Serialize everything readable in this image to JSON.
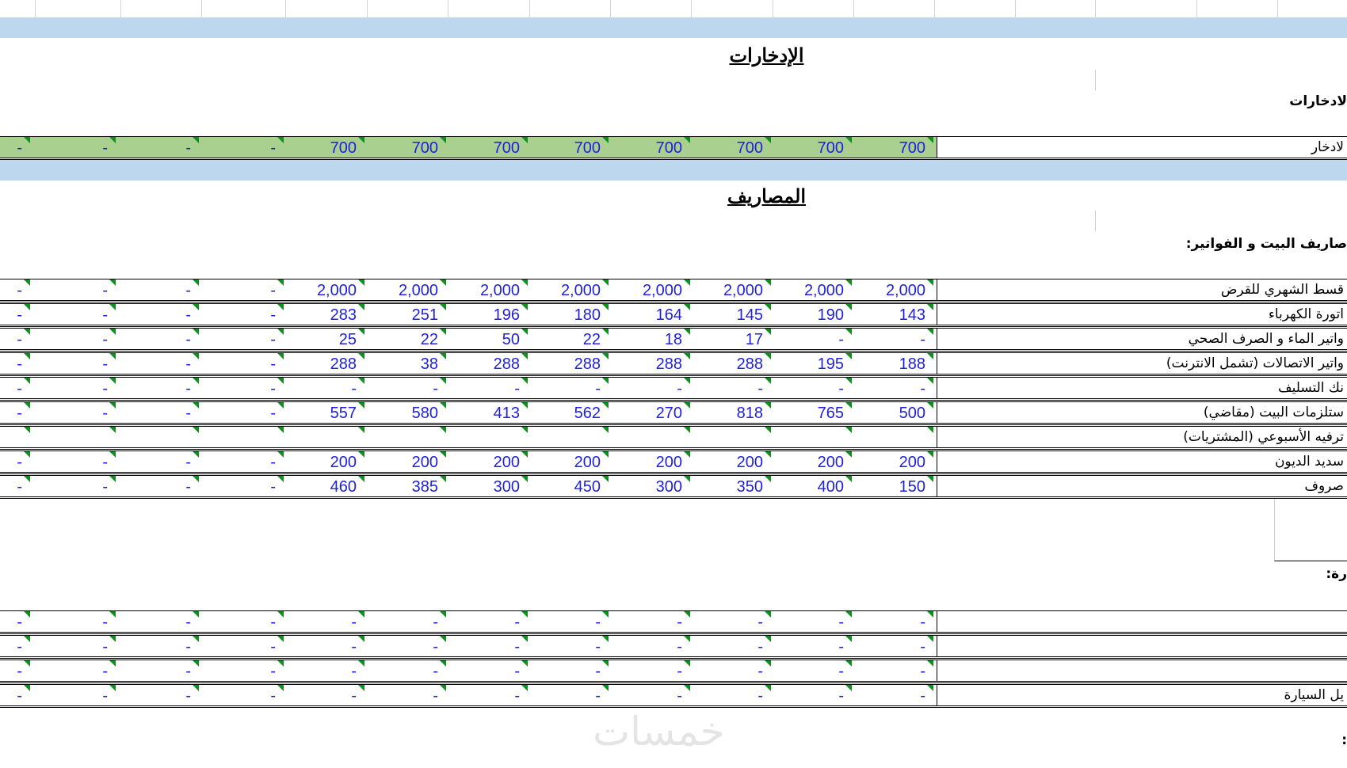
{
  "sections": {
    "savings_title": "الإدخارات",
    "expenses_title": "المصاريف"
  },
  "subheadings": {
    "savings": "لادخارات",
    "house_bills": "صاريف البيت و الفواتير:",
    "car": "رة:",
    "other": ":"
  },
  "savings_row": {
    "label": "لادخار",
    "values": [
      "-",
      "-",
      "-",
      "-",
      "700",
      "700",
      "700",
      "700",
      "700",
      "700",
      "700",
      "700"
    ]
  },
  "expense_rows": [
    {
      "label": "قسط الشهري للقرض",
      "values": [
        "-",
        "-",
        "-",
        "-",
        "2,000",
        "2,000",
        "2,000",
        "2,000",
        "2,000",
        "2,000",
        "2,000",
        "2,000"
      ]
    },
    {
      "label": "اتورة الكهرباء",
      "values": [
        "-",
        "-",
        "-",
        "-",
        "283",
        "251",
        "196",
        "180",
        "164",
        "145",
        "190",
        "143"
      ]
    },
    {
      "label": "واتير الماء و الصرف الصحي",
      "values": [
        "-",
        "-",
        "-",
        "-",
        "25",
        "22",
        "50",
        "22",
        "18",
        "17",
        "-",
        "-"
      ]
    },
    {
      "label": "واتير الاتصالات (تشمل الانترنت)",
      "values": [
        "-",
        "-",
        "-",
        "-",
        "288",
        "38",
        "288",
        "288",
        "288",
        "288",
        "195",
        "188"
      ]
    },
    {
      "label": "نك التسليف",
      "values": [
        "-",
        "-",
        "-",
        "-",
        "-",
        "-",
        "-",
        "-",
        "-",
        "-",
        "-",
        "-"
      ]
    },
    {
      "label": "ستلزمات البيت (مقاضي)",
      "values": [
        "-",
        "-",
        "-",
        "-",
        "557",
        "580",
        "413",
        "562",
        "270",
        "818",
        "765",
        "500"
      ]
    },
    {
      "label": "ترفيه الأسبوعي (المشتريات)",
      "values": [
        "",
        "",
        "",
        "",
        "",
        "",
        "",
        "",
        "",
        "",
        "",
        ""
      ]
    },
    {
      "label": "سديد الديون",
      "values": [
        "-",
        "-",
        "-",
        "-",
        "200",
        "200",
        "200",
        "200",
        "200",
        "200",
        "200",
        "200"
      ]
    },
    {
      "label": "صروف",
      "values": [
        "-",
        "-",
        "-",
        "-",
        "460",
        "385",
        "300",
        "450",
        "300",
        "350",
        "400",
        "150"
      ]
    }
  ],
  "car_rows": [
    {
      "label": "",
      "values": [
        "-",
        "-",
        "-",
        "-",
        "-",
        "-",
        "-",
        "-",
        "-",
        "-",
        "-",
        "-"
      ]
    },
    {
      "label": "",
      "values": [
        "-",
        "-",
        "-",
        "-",
        "-",
        "-",
        "-",
        "-",
        "-",
        "-",
        "-",
        "-"
      ]
    },
    {
      "label": "",
      "values": [
        "-",
        "-",
        "-",
        "-",
        "-",
        "-",
        "-",
        "-",
        "-",
        "-",
        "-",
        "-"
      ]
    },
    {
      "label": "يل السيارة",
      "values": [
        "-",
        "-",
        "-",
        "-",
        "-",
        "-",
        "-",
        "-",
        "-",
        "-",
        "-",
        "-"
      ]
    }
  ],
  "watermark": "خمسات",
  "colors": {
    "band": "#bdd7ee",
    "savings_fill": "#a9d08e",
    "value_text": "#1f1fdf",
    "comment_marker": "#0e8f1e"
  }
}
